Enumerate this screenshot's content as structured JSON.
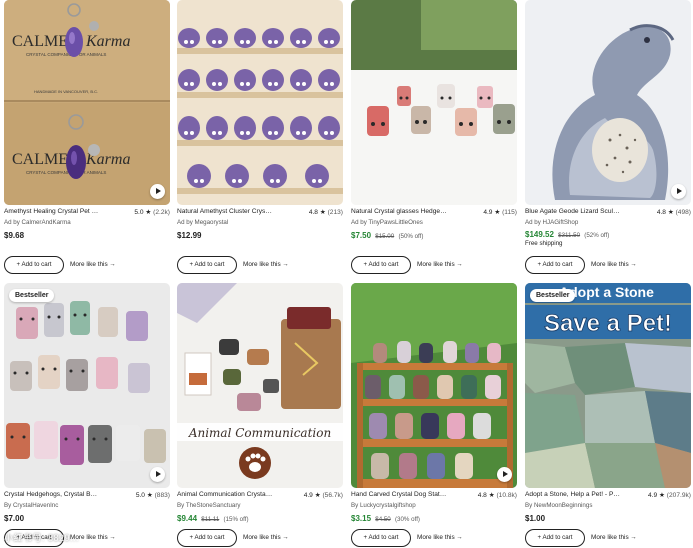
{
  "cards": [
    {
      "title": "Amethyst Healing Crystal Pet Co...",
      "rating": "5.0",
      "count": "(2.2k)",
      "seller": "Ad by CalmerAndKarma",
      "price": "$9.68",
      "orig": "",
      "pct": "",
      "ship": "",
      "badge": "",
      "cart_label": "+ Add to cart",
      "more_label": "More like this →",
      "image_text": {
        "line1": "CALMER",
        "line2": "Karma",
        "small": "CRYSTAL COMPANION FOR ANIMALS",
        "handmade": "HANDMADE IN VANCOUVER, B.C."
      }
    },
    {
      "title": "Natural Amethyst Cluster Crystal...",
      "rating": "4.8",
      "count": "(213)",
      "seller": "Ad by Megaorystal",
      "price": "$12.99",
      "orig": "",
      "pct": "",
      "ship": "",
      "badge": "",
      "cart_label": "+ Add to cart",
      "more_label": "More like this →"
    },
    {
      "title": "Natural Crystal glasses Hedgeho...",
      "rating": "4.9",
      "count": "(115)",
      "seller": "Ad by TinyPawsLittleOnes",
      "price": "$7.50",
      "orig": "$15.00",
      "pct": "(50% off)",
      "ship": "",
      "badge": "",
      "cart_label": "+ Add to cart",
      "more_label": "More like this →"
    },
    {
      "title": "Blue Agate Geode Lizard Sculpt...",
      "rating": "4.8",
      "count": "(498)",
      "seller": "Ad by HJAGiftShop",
      "price": "$149.52",
      "orig": "$311.50",
      "pct": "(52% off)",
      "ship": "Free shipping",
      "badge": "",
      "cart_label": "+ Add to cart",
      "more_label": "More like this →"
    },
    {
      "title": "Crystal Hedgehogs, Crystal Bud...",
      "rating": "5.0",
      "count": "(883)",
      "seller": "By CrystalHavenInc",
      "price": "$7.00",
      "orig": "",
      "pct": "",
      "ship": "",
      "badge": "Bestseller",
      "cart_label": "+ Add to cart",
      "more_label": "More like this →"
    },
    {
      "title": "Animal Communication Crystal ...",
      "rating": "4.9",
      "count": "(56.7k)",
      "seller": "By TheStoneSanctuary",
      "price": "$9.44",
      "orig": "$11.11",
      "pct": "(15% off)",
      "ship": "",
      "badge": "",
      "cart_label": "+ Add to cart",
      "more_label": "More like this →",
      "image_text": {
        "banner": "Animal Communication"
      }
    },
    {
      "title": "Hand Carved Crystal Dog Statue...",
      "rating": "4.8",
      "count": "(10.8k)",
      "seller": "By Luckycrystalgiftshop",
      "price": "$3.15",
      "orig": "$4.50",
      "pct": "(30% off)",
      "ship": "",
      "badge": "",
      "cart_label": "+ Add to cart",
      "more_label": "More like this →"
    },
    {
      "title": "Adopt a Stone, Help a Pet! - Proo...",
      "rating": "4.9",
      "count": "(207.9k)",
      "seller": "By NewMoonBeginnings",
      "price": "$1.00",
      "orig": "",
      "pct": "",
      "ship": "",
      "badge": "Bestseller",
      "cart_label": "+ Add to cart",
      "more_label": "More like this →",
      "image_text": {
        "line1": "Adopt a Stone",
        "line2": "Save a Pet!"
      }
    }
  ],
  "watermark": "小红书号: 8829...",
  "colors": {
    "sale": "#258635",
    "text": "#222222",
    "muted": "#595959"
  }
}
